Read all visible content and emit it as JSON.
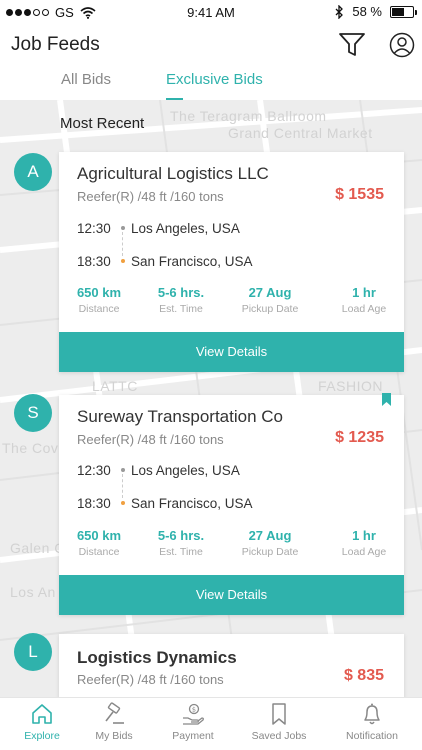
{
  "status_bar": {
    "carrier": "GS",
    "time": "9:41 AM",
    "battery": "58 %",
    "battery_level": 0.58
  },
  "header": {
    "title": "Job Feeds",
    "filter_icon": "filter-icon",
    "profile_icon": "user-icon"
  },
  "tabs": [
    {
      "label": "All Bids",
      "active": false
    },
    {
      "label": "Exclusive Bids",
      "active": true
    }
  ],
  "section_title": "Most Recent",
  "map_labels": [
    "The Teragram Ballroom",
    "Grand Central Market",
    "LATTC",
    "FASHION",
    "The Cove",
    "Galen C",
    "Los An"
  ],
  "jobs": [
    {
      "initial": "A",
      "company": "Agricultural Logistics LLC",
      "specs": "Reefer(R) /48 ft /160 tons",
      "price": "$ 1535",
      "bookmarked": false,
      "pickup_time": "12:30",
      "pickup_city": "Los Angeles, USA",
      "drop_time": "18:30",
      "drop_city": "San Francisco, USA",
      "stats": [
        {
          "value": "650 km",
          "label": "Distance"
        },
        {
          "value": "5-6 hrs.",
          "label": "Est. Time"
        },
        {
          "value": "27 Aug",
          "label": "Pickup Date"
        },
        {
          "value": "1 hr",
          "label": "Load Age"
        }
      ],
      "button": "View Details"
    },
    {
      "initial": "S",
      "company": "Sureway Transportation Co",
      "specs": "Reefer(R) /48 ft /160 tons",
      "price": "$ 1235",
      "bookmarked": true,
      "pickup_time": "12:30",
      "pickup_city": "Los Angeles, USA",
      "drop_time": "18:30",
      "drop_city": "San Francisco, USA",
      "stats": [
        {
          "value": "650 km",
          "label": "Distance"
        },
        {
          "value": "5-6 hrs.",
          "label": "Est. Time"
        },
        {
          "value": "27 Aug",
          "label": "Pickup Date"
        },
        {
          "value": "1 hr",
          "label": "Load Age"
        }
      ],
      "button": "View Details"
    },
    {
      "initial": "L",
      "company": "Logistics Dynamics",
      "specs": "Reefer(R) /48 ft /160 tons",
      "price": "$ 835",
      "bookmarked": false
    }
  ],
  "bottom_nav": [
    {
      "label": "Explore",
      "icon": "home-icon",
      "active": true
    },
    {
      "label": "My Bids",
      "icon": "gavel-icon",
      "active": false
    },
    {
      "label": "Payment",
      "icon": "payment-hand-icon",
      "active": false
    },
    {
      "label": "Saved Jobs",
      "icon": "bookmark-icon",
      "active": false
    },
    {
      "label": "Notification",
      "icon": "bell-icon",
      "active": false
    }
  ],
  "colors": {
    "accent": "#2fb2ac",
    "price": "#e35a4f",
    "pickup_dot": "#9a9a9a",
    "drop_dot": "#f0a040"
  }
}
